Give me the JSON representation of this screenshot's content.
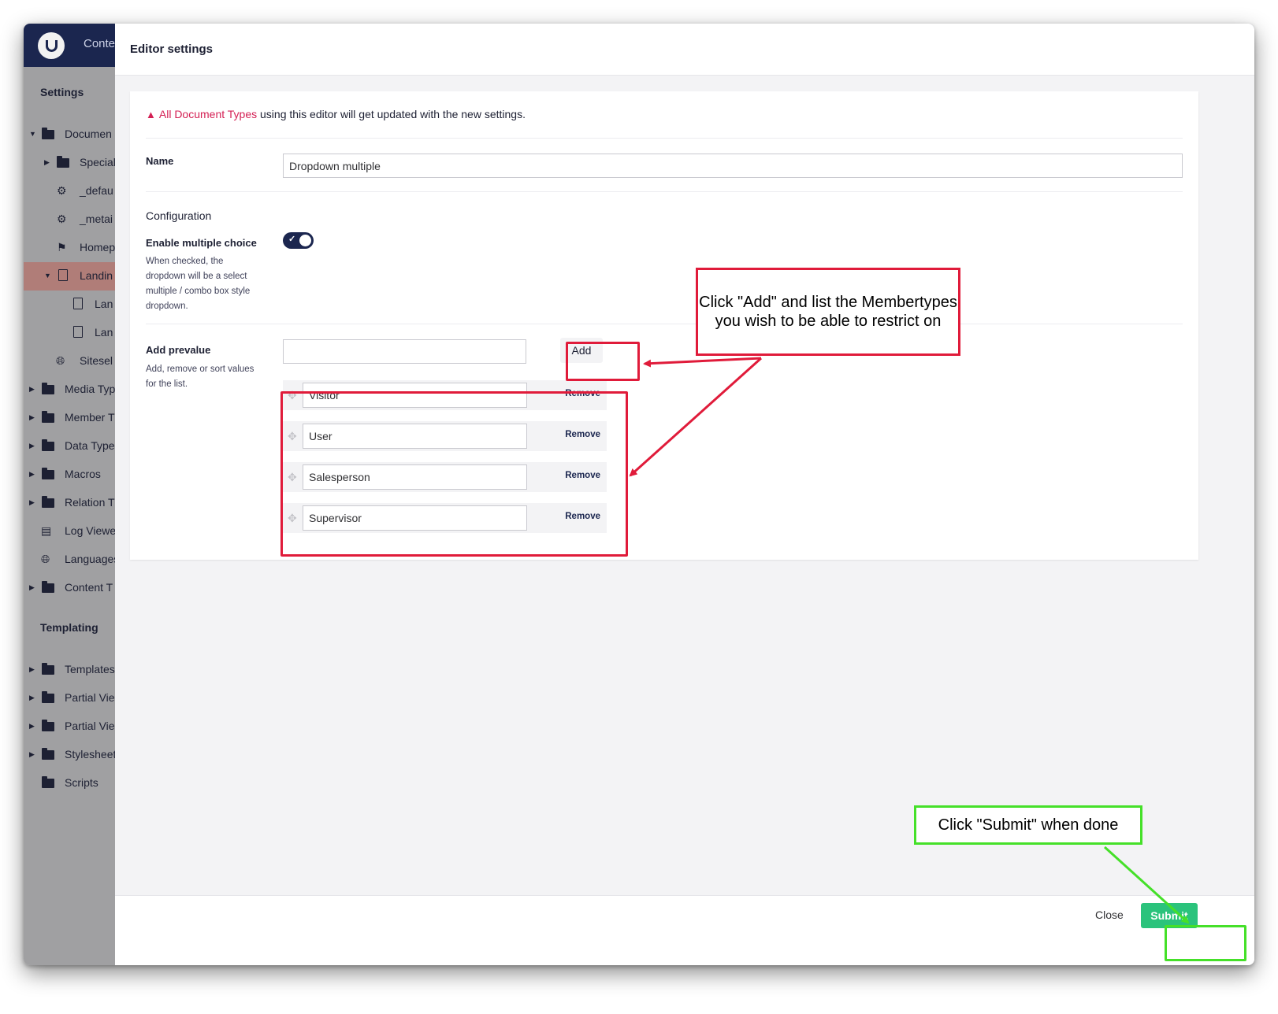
{
  "topbar": {
    "nav_label": "Conte"
  },
  "sidebar": {
    "settings_heading": "Settings",
    "templating_heading": "Templating",
    "items": [
      {
        "label": "Documen",
        "icon": "folder-icon",
        "caret": "expanded"
      },
      {
        "label": "Special",
        "icon": "folder-icon",
        "caret": "collapsed"
      },
      {
        "label": "_defau",
        "icon": "gears-icon"
      },
      {
        "label": "_metai",
        "icon": "gears-icon"
      },
      {
        "label": "Homep",
        "icon": "flag-icon"
      },
      {
        "label": "Landin",
        "icon": "document-icon",
        "caret": "expanded",
        "active": true
      },
      {
        "label": "Lan",
        "icon": "document-icon"
      },
      {
        "label": "Lan",
        "icon": "document-icon"
      },
      {
        "label": "Sitesel",
        "icon": "globe-icon"
      },
      {
        "label": "Media Typ",
        "icon": "folder-icon",
        "caret": "collapsed"
      },
      {
        "label": "Member T",
        "icon": "folder-icon",
        "caret": "collapsed"
      },
      {
        "label": "Data Type",
        "icon": "folder-icon",
        "caret": "collapsed"
      },
      {
        "label": "Macros",
        "icon": "folder-icon",
        "caret": "collapsed"
      },
      {
        "label": "Relation T",
        "icon": "folder-icon",
        "caret": "collapsed"
      },
      {
        "label": "Log Viewe",
        "icon": "archive-icon"
      },
      {
        "label": "Languages",
        "icon": "globe-icon"
      },
      {
        "label": "Content T",
        "icon": "folder-icon",
        "caret": "collapsed"
      }
    ],
    "templating_items": [
      {
        "label": "Templates",
        "icon": "folder-icon",
        "caret": "collapsed"
      },
      {
        "label": "Partial Vie",
        "icon": "folder-icon",
        "caret": "collapsed"
      },
      {
        "label": "Partial Vie",
        "icon": "folder-icon",
        "caret": "collapsed"
      },
      {
        "label": "Stylesheet",
        "icon": "folder-icon",
        "caret": "collapsed"
      },
      {
        "label": "Scripts",
        "icon": "folder-icon"
      }
    ]
  },
  "modal": {
    "title": "Editor settings",
    "notice": {
      "link_text": "All Document Types",
      "text": " using this editor will get updated with the new settings."
    },
    "name_label": "Name",
    "name_value": "Dropdown multiple",
    "configuration_title": "Configuration",
    "multiple": {
      "label": "Enable multiple choice",
      "description": "When checked, the dropdown will be a select multiple / combo box style dropdown.",
      "checked": true
    },
    "prevalue": {
      "label": "Add prevalue",
      "description": "Add, remove or sort values for the list.",
      "new_value": "",
      "add_label": "Add",
      "remove_label": "Remove",
      "items": [
        "Visitor",
        "User",
        "Salesperson",
        "Supervisor"
      ]
    },
    "footer": {
      "close_label": "Close",
      "submit_label": "Submit"
    }
  },
  "annotations": {
    "add_callout": "Click \"Add\" and list the Membertypes you wish to be able to restrict on",
    "submit_callout": "Click \"Submit\" when done",
    "red": "#e01b3a",
    "green": "#45e029"
  },
  "colors": {
    "topbar": "#1b264f",
    "accent": "#d42054",
    "submit": "#2bc37c"
  }
}
